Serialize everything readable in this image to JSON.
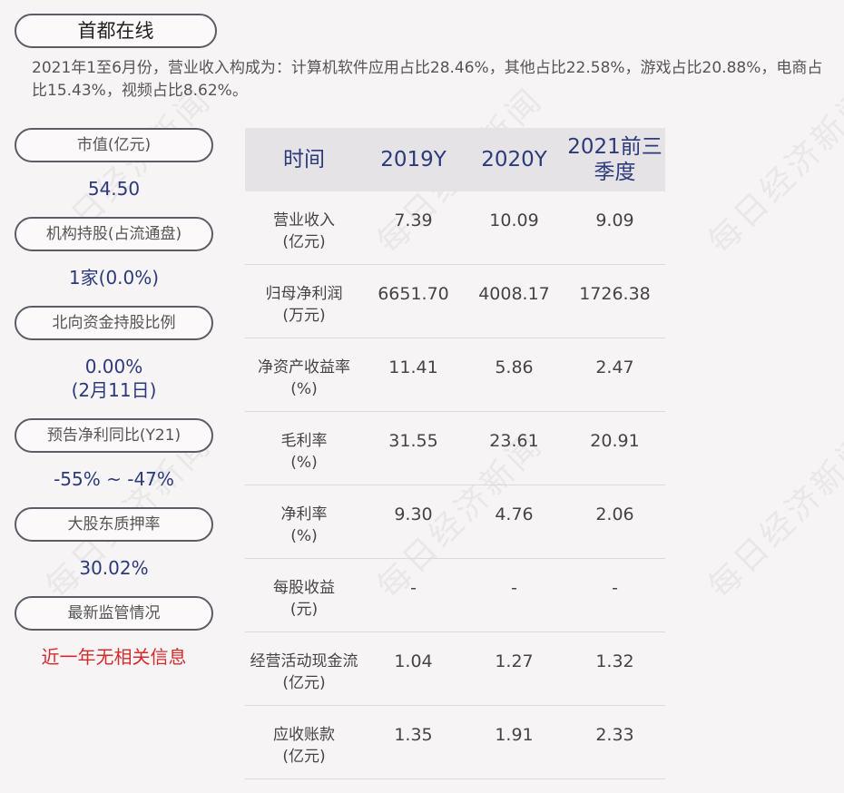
{
  "brand": "首都在线",
  "summary": "2021年1至6月份，营业收入构成为：计算机软件应用占比28.46%，其他占比22.58%，游戏占比20.88%，电商占比15.43%，视频占比8.62%。",
  "watermark": "每日经济新闻",
  "sidebar": [
    {
      "label": "市值(亿元)",
      "value": "54.50"
    },
    {
      "label": "机构持股(占流通盘)",
      "value": "1家(0.0%)"
    },
    {
      "label": "北向资金持股比例",
      "value": "0.00%",
      "value2": "(2月11日)"
    },
    {
      "label": "预告净利同比(Y21)",
      "value": "-55% ~ -47%"
    },
    {
      "label": "大股东质押率",
      "value": "30.02%"
    },
    {
      "label": "最新监管情况",
      "value": "近一年无相关信息"
    }
  ],
  "table": {
    "headers": [
      "时间",
      "2019Y",
      "2020Y",
      "2021前三季度"
    ],
    "rows": [
      {
        "label": "营业收入",
        "unit": "(亿元)",
        "values": [
          "7.39",
          "10.09",
          "9.09"
        ]
      },
      {
        "label": "归母净利润",
        "unit": "(万元)",
        "values": [
          "6651.70",
          "4008.17",
          "1726.38"
        ]
      },
      {
        "label": "净资产收益率",
        "unit": "(%)",
        "values": [
          "11.41",
          "5.86",
          "2.47"
        ]
      },
      {
        "label": "毛利率",
        "unit": "(%)",
        "values": [
          "31.55",
          "23.61",
          "20.91"
        ]
      },
      {
        "label": "净利率",
        "unit": "(%)",
        "values": [
          "9.30",
          "4.76",
          "2.06"
        ]
      },
      {
        "label": "每股收益",
        "unit": "(元)",
        "values": [
          "-",
          "-",
          "-"
        ]
      },
      {
        "label": "经营活动现金流",
        "unit": "(亿元)",
        "values": [
          "1.04",
          "1.27",
          "1.32"
        ]
      },
      {
        "label": "应收账款",
        "unit": "(亿元)",
        "values": [
          "1.35",
          "1.91",
          "2.33"
        ]
      }
    ]
  },
  "colors": {
    "accent": "#2b3a7a",
    "alert": "#d62b2b",
    "header_bg": "#e6e3e6"
  }
}
